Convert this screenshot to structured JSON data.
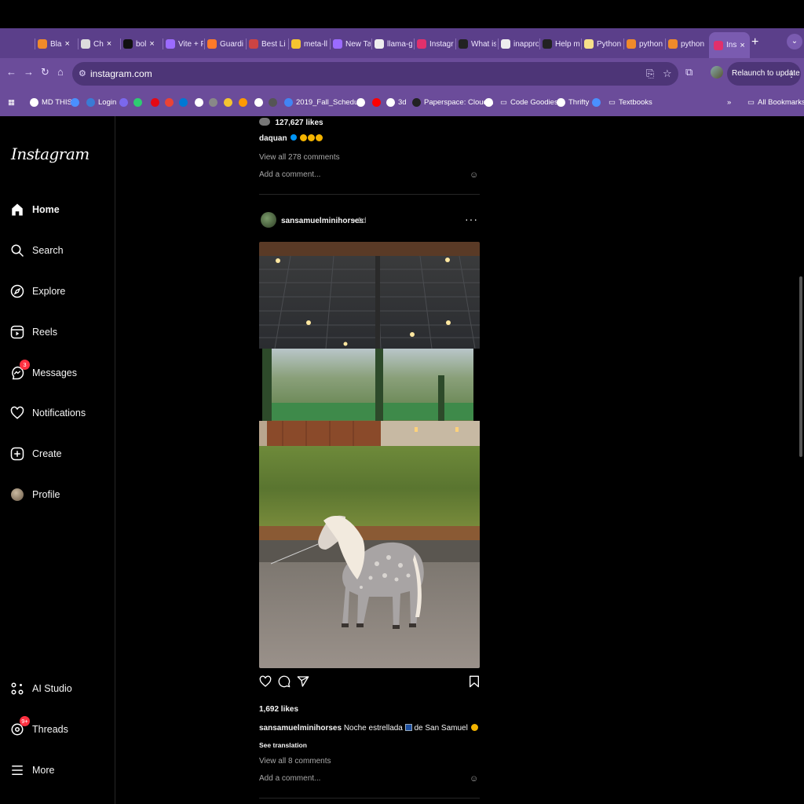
{
  "browser": {
    "tabs": [
      {
        "label": "Bla",
        "fav": "#f08a2a"
      },
      {
        "label": "Ch",
        "fav": "#dddddd"
      },
      {
        "label": "bol",
        "fav": "#111111"
      },
      {
        "label": "Vite + F",
        "fav": "#9b6bff"
      },
      {
        "label": "Guardi",
        "fav": "#ff7a2a"
      },
      {
        "label": "Best Li",
        "fav": "#cc4444"
      },
      {
        "label": "meta-ll",
        "fav": "#f4c430"
      },
      {
        "label": "New Ta",
        "fav": "#9b6bff"
      },
      {
        "label": "llama-g",
        "fav": "#eeeeee"
      },
      {
        "label": "Instagr",
        "fav": "#e1306c"
      },
      {
        "label": "What is",
        "fav": "#222222"
      },
      {
        "label": "inappro",
        "fav": "#eeeeee"
      },
      {
        "label": "Help m",
        "fav": "#222222"
      },
      {
        "label": "Python",
        "fav": "#f7e08a"
      },
      {
        "label": "python",
        "fav": "#f08a2a"
      },
      {
        "label": "python",
        "fav": "#f08a2a"
      }
    ],
    "active_tab": {
      "label": "Ins",
      "fav": "#e1306c"
    },
    "new_tab": "+",
    "url": "instagram.com",
    "relaunch": "Relaunch to update",
    "bookmarks": [
      {
        "label": "MD THIS",
        "color": "#ffffff"
      },
      {
        "label": "",
        "color": "#4a90ff"
      },
      {
        "label": "Login",
        "color": "#3a7bd5"
      },
      {
        "label": "",
        "color": "#7b68ee"
      },
      {
        "label": "",
        "color": "#2ecc71"
      },
      {
        "label": "",
        "color": "#e50914"
      },
      {
        "label": "",
        "color": "#ea4335"
      },
      {
        "label": "",
        "color": "#0078d4"
      },
      {
        "label": "",
        "color": "#ffffff"
      },
      {
        "label": "",
        "color": "#888888"
      },
      {
        "label": "",
        "color": "#f4c430"
      },
      {
        "label": "",
        "color": "#ff9900"
      },
      {
        "label": "",
        "color": "#ffffff"
      },
      {
        "label": "",
        "color": "#555555"
      },
      {
        "label": "2019_Fall_Schedu...",
        "color": "#4285f4"
      },
      {
        "label": "",
        "color": "#ffffff"
      },
      {
        "label": "",
        "color": "#ff0000"
      },
      {
        "label": "3d",
        "color": "#ffffff"
      },
      {
        "label": "Paperspace: Cloud...",
        "color": "#222222"
      },
      {
        "label": "",
        "color": "#ffffff"
      },
      {
        "label": "Code Goodies",
        "color": "folder"
      },
      {
        "label": "Thrifty",
        "color": "#ffffff"
      },
      {
        "label": "",
        "color": "#4a90ff"
      },
      {
        "label": "Textbooks",
        "color": "folder"
      }
    ],
    "more_bookmarks": "»",
    "all_bookmarks": "All Bookmarks"
  },
  "sidebar": {
    "logo": "Instagram",
    "items": [
      {
        "label": "Home",
        "icon": "home-icon",
        "bold": true
      },
      {
        "label": "Search",
        "icon": "search-icon"
      },
      {
        "label": "Explore",
        "icon": "compass-icon"
      },
      {
        "label": "Reels",
        "icon": "reels-icon"
      },
      {
        "label": "Messages",
        "icon": "messenger-icon",
        "badge": "3"
      },
      {
        "label": "Notifications",
        "icon": "heart-icon"
      },
      {
        "label": "Create",
        "icon": "plus-square-icon"
      },
      {
        "label": "Profile",
        "icon": "avatar"
      }
    ],
    "bottom_items": [
      {
        "label": "AI Studio",
        "icon": "ai-studio-icon"
      },
      {
        "label": "Threads",
        "icon": "threads-icon",
        "badge": "9+"
      },
      {
        "label": "More",
        "icon": "menu-icon"
      }
    ]
  },
  "feed": {
    "prev_post": {
      "likes": "127,627 likes",
      "caption_user": "daquan",
      "view_comments": "View all 278 comments",
      "add_comment": "Add a comment..."
    },
    "post": {
      "username": "sansamuelminihorses",
      "time": "• 1d",
      "likes": "1,692 likes",
      "caption_user": "sansamuelminihorses",
      "caption_text": "Noche estrellada",
      "caption_tail": "de San Samuel",
      "see_translation": "See translation",
      "view_comments": "View all 8 comments",
      "add_comment": "Add a comment..."
    }
  }
}
